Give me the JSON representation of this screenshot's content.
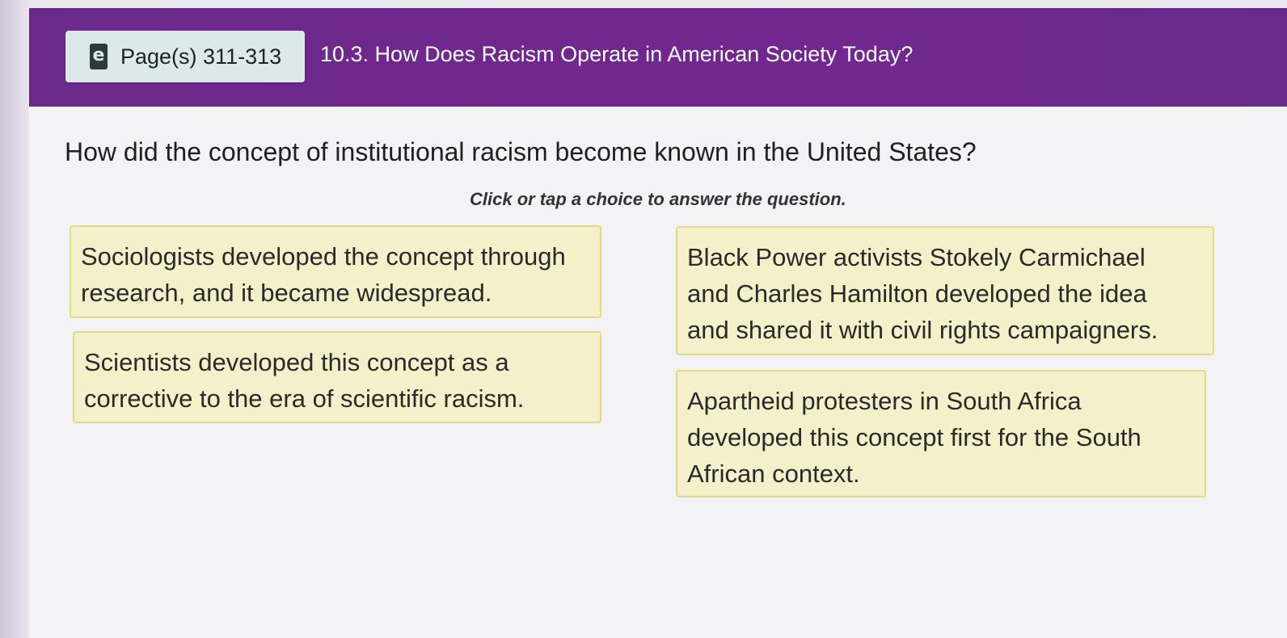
{
  "header": {
    "page_button": {
      "icon": "ebook-icon",
      "icon_letter": "e",
      "label": "Page(s) 311-313"
    },
    "section_title": "10.3. How Does Racism Operate in American Society Today?",
    "colors": {
      "header_bg": "#6f288e",
      "page_button_bg": "#dce8e9"
    }
  },
  "question": {
    "text": "How did the concept of institutional racism become known in the United States?",
    "instruction": "Click or tap a choice to answer the question."
  },
  "choices": [
    {
      "lines": [
        "Sociologists developed the concept through",
        "research, and it became widespread."
      ]
    },
    {
      "lines": [
        "Scientists developed this concept as a",
        "corrective to the era of scientific racism."
      ]
    },
    {
      "lines": [
        "Black Power activists Stokely Carmichael",
        "and Charles Hamilton developed the idea",
        "and shared it with civil rights campaigners."
      ]
    },
    {
      "lines": [
        "Apartheid protesters in South Africa",
        "developed this concept first for the South",
        "African context."
      ]
    }
  ],
  "colors": {
    "choice_bg": "#f4f0c9",
    "choice_border": "#e1d98a"
  }
}
